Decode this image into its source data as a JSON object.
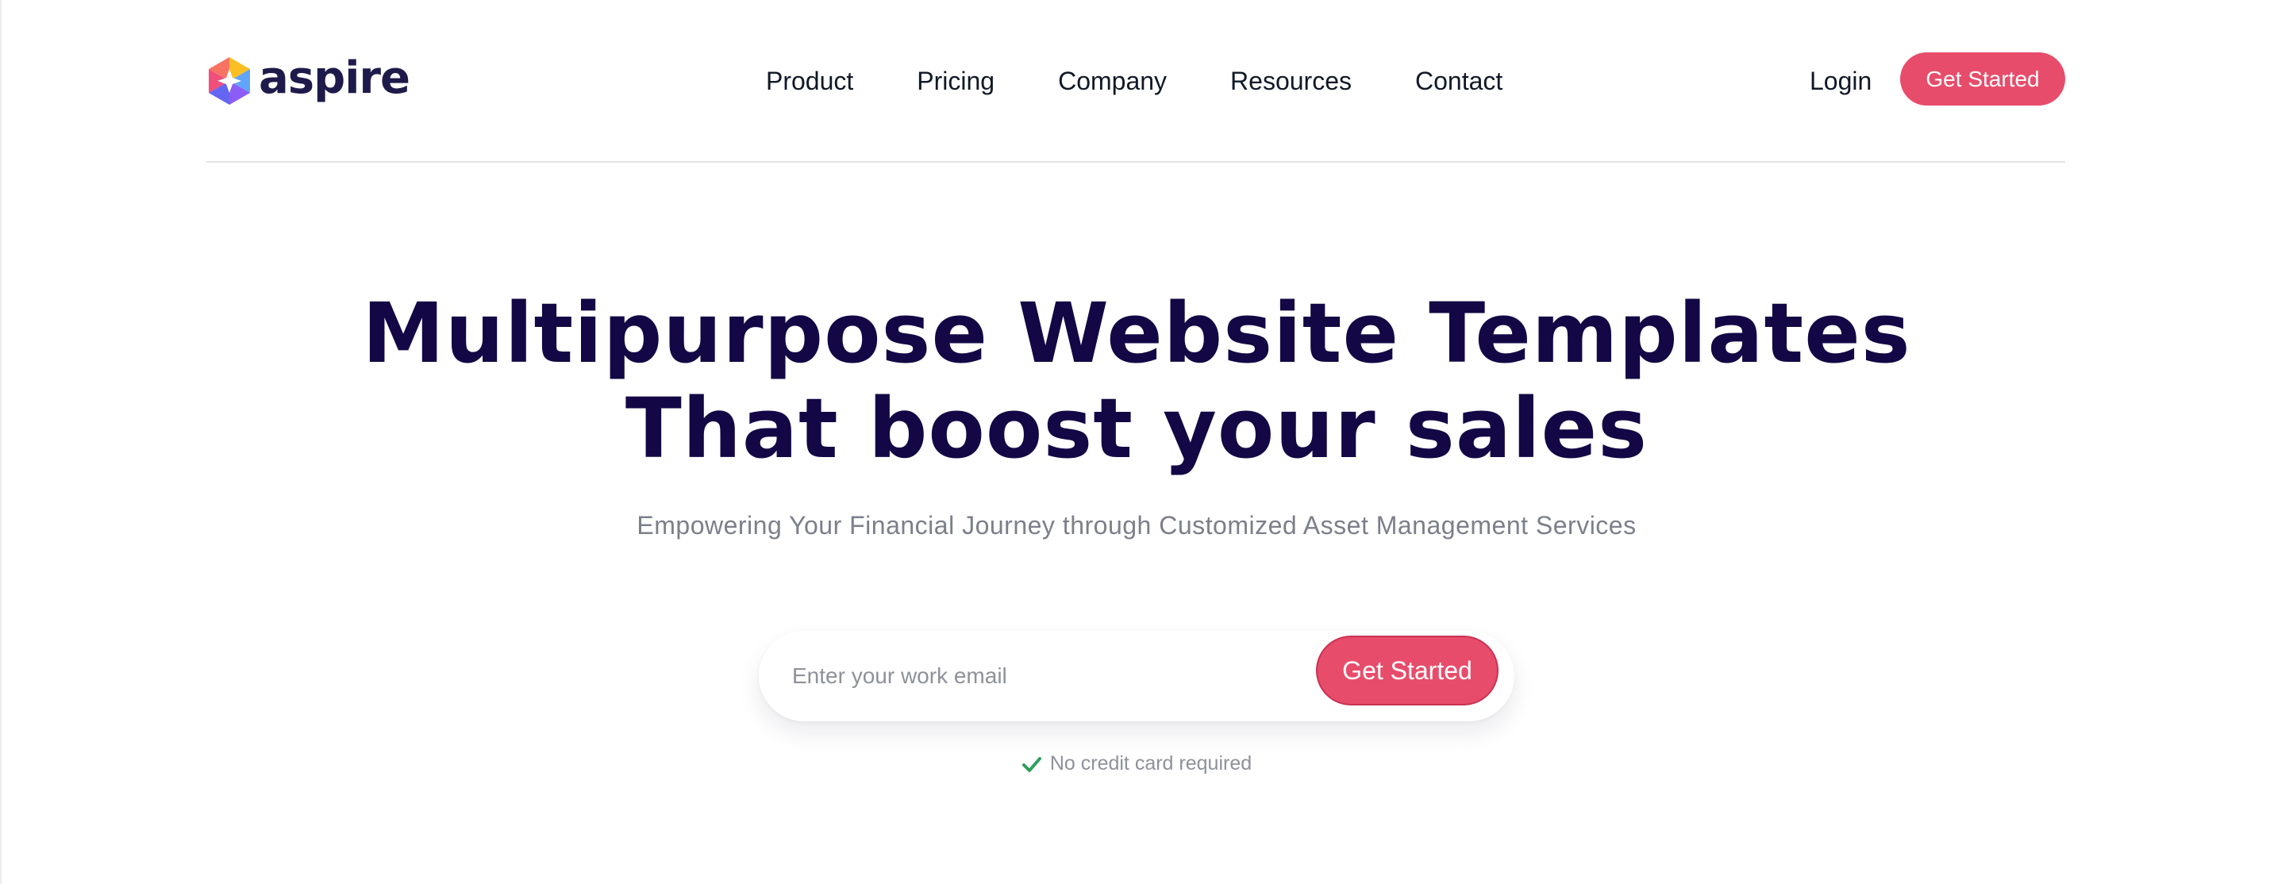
{
  "header": {
    "logo_text": "aspire",
    "nav": [
      "Product",
      "Pricing",
      "Company",
      "Resources",
      "Contact"
    ],
    "login_label": "Login",
    "cta_label": "Get Started"
  },
  "hero": {
    "title_line1": "Multipurpose Website Templates",
    "title_line2": "That boost your sales",
    "subtitle": "Empowering Your Financial Journey through Customized Asset Management Services",
    "email_placeholder": "Enter your work email",
    "cta_label": "Get Started",
    "note": "No credit card required",
    "note_icon": "check-icon"
  },
  "colors": {
    "brand_pink": "#e84c6b",
    "heading_navy": "#130845",
    "logo_navy": "#1e1b4b",
    "check_green": "#2f9e5b"
  }
}
